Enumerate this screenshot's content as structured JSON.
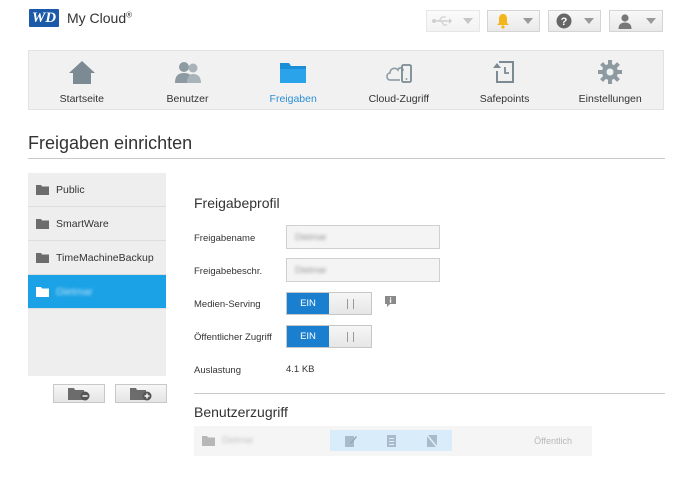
{
  "header": {
    "brand_logo": "WD",
    "brand_name": "My Cloud",
    "brand_mark": "®",
    "icons": [
      "usb-icon",
      "bell-icon",
      "help-icon",
      "user-icon"
    ]
  },
  "nav": {
    "items": [
      {
        "label": "Startseite",
        "icon": "home-icon"
      },
      {
        "label": "Benutzer",
        "icon": "users-icon"
      },
      {
        "label": "Freigaben",
        "icon": "folder-icon"
      },
      {
        "label": "Cloud-Zugriff",
        "icon": "cloud-device-icon"
      },
      {
        "label": "Safepoints",
        "icon": "safepoint-icon"
      },
      {
        "label": "Einstellungen",
        "icon": "gear-icon"
      }
    ],
    "active": "Freigaben"
  },
  "page": {
    "title": "Freigaben einrichten"
  },
  "shares": {
    "items": [
      "Public",
      "SmartWare",
      "TimeMachineBackup",
      "Dietmar"
    ],
    "selected_index": 3
  },
  "profile": {
    "title": "Freigabeprofil",
    "name_label": "Freigabename",
    "name_value": "Dietmar",
    "desc_label": "Freigabebeschr.",
    "desc_value": "Dietmar",
    "media_label": "Medien-Serving",
    "media_toggle": "EIN",
    "public_label": "Öffentlicher Zugriff",
    "public_toggle": "EIN",
    "usage_label": "Auslastung",
    "usage_value": "4.1 KB"
  },
  "access": {
    "title": "Benutzerzugriff",
    "row_name": "Dietmar",
    "row_status": "Öffentlich"
  },
  "colors": {
    "accent": "#1aa1e6",
    "toggle_on": "#1b7fd0",
    "bell": "#f2b61a"
  }
}
